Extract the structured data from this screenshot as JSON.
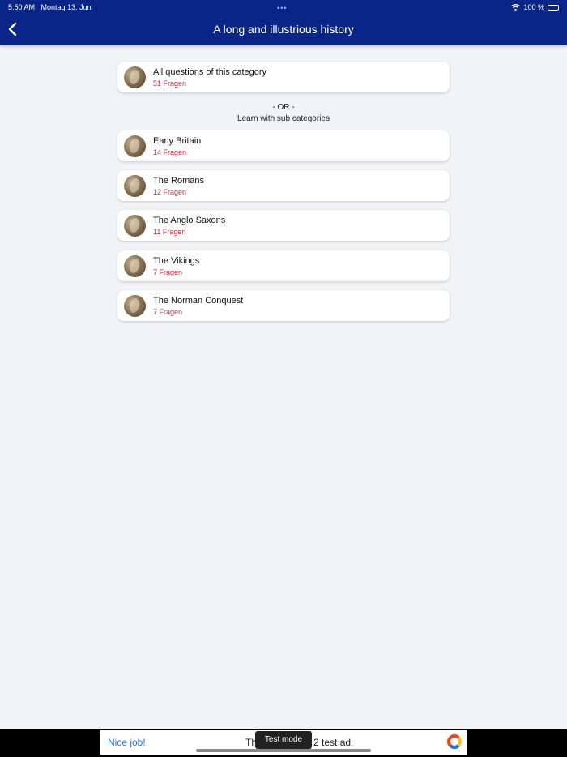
{
  "status": {
    "time": "5:50 AM",
    "date": "Montag 13. Juni",
    "battery": "100 %"
  },
  "header": {
    "title": "A long and illustrious history"
  },
  "all_card": {
    "name": "All questions of this category",
    "count": "51 Fragen"
  },
  "divider": {
    "or": "- OR -",
    "sub": "Learn with sub categories"
  },
  "categories": [
    {
      "name": "Early Britain",
      "count": "14 Fragen"
    },
    {
      "name": "The Romans",
      "count": "12 Fragen"
    },
    {
      "name": "The Anglo Saxons",
      "count": "11 Fragen"
    },
    {
      "name": "The Vikings",
      "count": "7 Fragen"
    },
    {
      "name": "The Norman Conquest",
      "count": "7 Fragen"
    }
  ],
  "ad": {
    "cta": "Nice job!",
    "text_left": "Th",
    "text_right": "2 test ad.",
    "badge": "Test mode"
  },
  "colors": {
    "header_bg": "#0a2588",
    "count_text": "#d0243c",
    "cta_text": "#2f6fe3"
  }
}
